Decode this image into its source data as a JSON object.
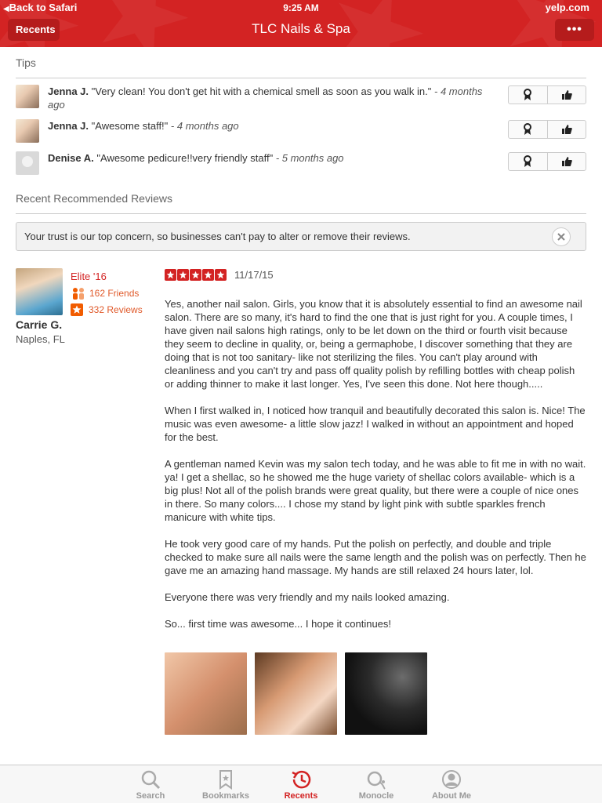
{
  "status_bar": {
    "back_label": "Back to Safari",
    "time": "9:25 AM",
    "domain": "yelp.com"
  },
  "nav": {
    "back_button": "Recents",
    "title": "TLC Nails & Spa",
    "more_button": "•••"
  },
  "tips_section": {
    "title": "Tips",
    "items": [
      {
        "author": "Jenna J.",
        "text": "\"Very clean! You don't get hit with a chemical smell as soon as you walk in.\"",
        "time": "- 4 months ago"
      },
      {
        "author": "Jenna J.",
        "text": "\"Awesome staff!\"",
        "time": "- 4 months ago"
      },
      {
        "author": "Denise A.",
        "text": "\"Awesome pedicure!!very friendly staff\"",
        "time": "- 5 months ago"
      }
    ]
  },
  "reviews_section": {
    "title": "Recent Recommended Reviews",
    "trust_notice": "Your trust is our top concern, so businesses can't pay to alter or remove their reviews."
  },
  "review": {
    "elite": "Elite '16",
    "friends": "162 Friends",
    "reviews_count": "332 Reviews",
    "reviewer_name": "Carrie G.",
    "reviewer_location": "Naples, FL",
    "rating": 5,
    "date": "11/17/15",
    "paragraphs": [
      "Yes, another nail salon.  Girls, you know that it is absolutely essential to find an awesome nail salon.  There are so many, it's hard to find the one that is just right for you.  A couple times, I have given nail salons high ratings, only to be let down on the third or fourth visit because they seem to decline in quality, or, being a germaphobe, I discover something that they are doing that is not too sanitary- like not sterilizing the files.  You can't play around with cleanliness and you can't try and pass off quality polish by refilling bottles with cheap polish or adding thinner to make it last longer.  Yes, I've seen this done.  Not here though.....",
      "When I first walked in, I noticed how tranquil and beautifully decorated this salon is.  Nice!  The music was even awesome- a little slow jazz!  I walked in without an appointment and hoped for the best.",
      "A gentleman named Kevin was my salon tech today, and he was able to fit me in with no wait.  ya!  I get a shellac, so he showed me the huge variety of shellac colors available- which is a big plus!  Not all of the polish brands were great quality, but there were a couple of nice ones in there.  So many colors.... I chose my stand by light pink with subtle sparkles french manicure with white tips.",
      "He took very good care of my hands.  Put the polish on perfectly, and double and triple checked to make sure all nails were the same length and the polish was on perfectly.  Then he gave me an amazing hand massage.  My hands are still relaxed 24 hours later, lol.",
      "Everyone there was very friendly and my nails looked amazing.",
      "So... first time was awesome... I hope it continues!"
    ]
  },
  "tabbar": {
    "search": "Search",
    "bookmarks": "Bookmarks",
    "recents": "Recents",
    "monocle": "Monocle",
    "about_me": "About Me"
  },
  "colors": {
    "brand": "#d32323",
    "orange": "#e05a2b",
    "tab_inactive": "#999999"
  }
}
